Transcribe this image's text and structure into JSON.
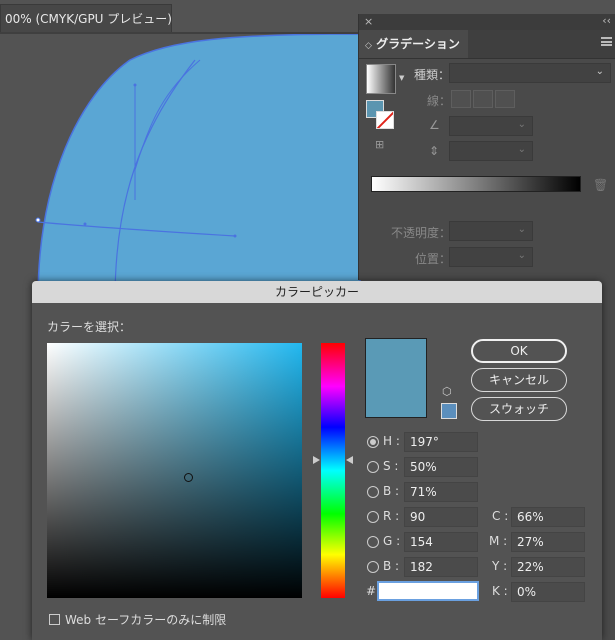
{
  "document": {
    "tab_title": "00% (CMYK/GPU プレビュー)"
  },
  "gradient_panel": {
    "close_glyph": "×",
    "collapse_glyph": "‹‹",
    "tab_label": "グラデーション",
    "type_label": "種類：",
    "stroke_label": "線：",
    "opacity_label": "不透明度：",
    "position_label": "位置："
  },
  "color_picker": {
    "title": "カラーピッカー",
    "select_label": "カラーを選択：",
    "ok_label": "OK",
    "cancel_label": "キャンセル",
    "swatches_label": "スウォッチ",
    "current_color": "#5a9ab6",
    "hsb": {
      "h_label": "H :",
      "h_value": "197°",
      "s_label": "S :",
      "s_value": "50%",
      "b_label": "B :",
      "b_value": "71%"
    },
    "rgb": {
      "r_label": "R :",
      "r_value": "90",
      "g_label": "G :",
      "g_value": "154",
      "b_label": "B :",
      "b_value": "182"
    },
    "cmyk": {
      "c_label": "C :",
      "c_value": "66%",
      "m_label": "M :",
      "m_value": "27%",
      "y_label": "Y :",
      "y_value": "22%",
      "k_label": "K :",
      "k_value": "0%"
    },
    "hex_label": "#",
    "hex_value": "",
    "web_only_label": "Web セーフカラーのみに制限"
  }
}
